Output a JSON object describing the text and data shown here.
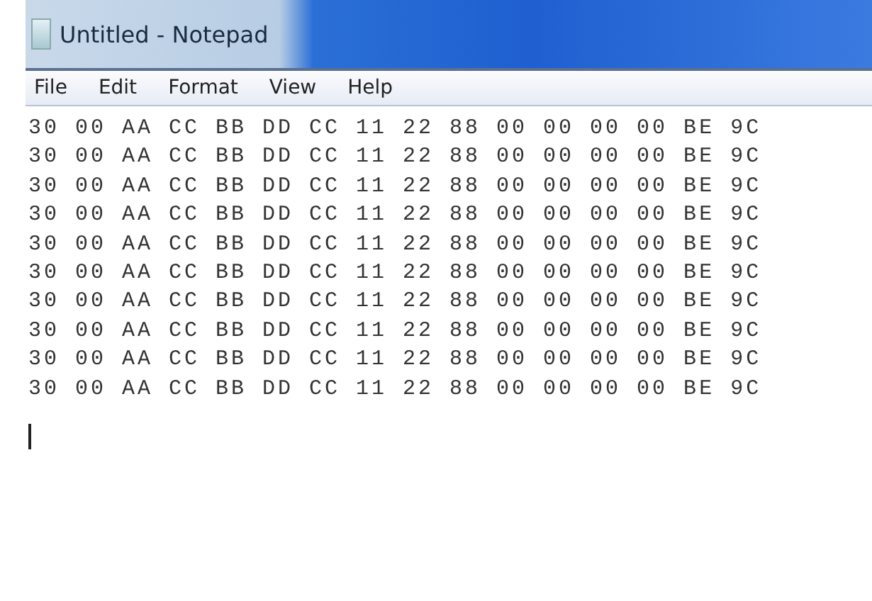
{
  "window": {
    "title": "Untitled - Notepad"
  },
  "menu": [
    "File",
    "Edit",
    "Format",
    "View",
    "Help"
  ],
  "editor": {
    "lines": [
      "30 00 AA CC BB DD CC 11 22 88 00 00 00 00 BE 9C",
      "30 00 AA CC BB DD CC 11 22 88 00 00 00 00 BE 9C",
      "30 00 AA CC BB DD CC 11 22 88 00 00 00 00 BE 9C",
      "30 00 AA CC BB DD CC 11 22 88 00 00 00 00 BE 9C",
      "30 00 AA CC BB DD CC 11 22 88 00 00 00 00 BE 9C",
      "30 00 AA CC BB DD CC 11 22 88 00 00 00 00 BE 9C",
      "30 00 AA CC BB DD CC 11 22 88 00 00 00 00 BE 9C",
      "30 00 AA CC BB DD CC 11 22 88 00 00 00 00 BE 9C",
      "30 00 AA CC BB DD CC 11 22 88 00 00 00 00 BE 9C",
      "30 00 AA CC BB DD CC 11 22 88 00 00 00 00 BE 9C"
    ]
  }
}
